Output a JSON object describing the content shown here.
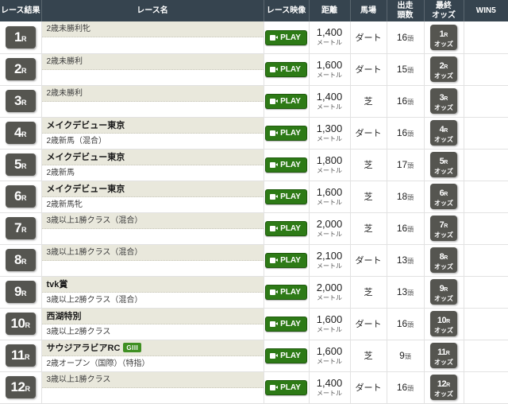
{
  "table": {
    "headers": {
      "result": "レース結果",
      "race_name": "レース名",
      "video": "レース映像",
      "distance": "距離",
      "surface": "馬場",
      "heads_line1": "出走",
      "heads_line2": "頭数",
      "odds_line1": "最終",
      "odds_line2": "オッズ",
      "win5": "WIN5"
    },
    "labels": {
      "r_suffix": "R",
      "play": "PLAY",
      "distance_unit": "メートル",
      "heads_unit": "頭",
      "odds_label": "オッズ"
    },
    "colors": {
      "header_bg": "#36444f",
      "r_button_bg": "#555550",
      "play_button_bg": "#2d7a16",
      "grade_badge_bg": "#3f8f22",
      "name_top_bg": "#e9e8dc"
    },
    "rows": [
      {
        "race_no": "1",
        "name": "2歳未勝利牝",
        "name_is_title": false,
        "condition": "",
        "grade": "",
        "video": "PLAY",
        "distance": "1,400",
        "surface": "ダート",
        "heads": "16",
        "odds_no": "1",
        "win5": ""
      },
      {
        "race_no": "2",
        "name": "2歳未勝利",
        "name_is_title": false,
        "condition": "",
        "grade": "",
        "video": "PLAY",
        "distance": "1,600",
        "surface": "ダート",
        "heads": "15",
        "odds_no": "2",
        "win5": ""
      },
      {
        "race_no": "3",
        "name": "2歳未勝利",
        "name_is_title": false,
        "condition": "",
        "grade": "",
        "video": "PLAY",
        "distance": "1,400",
        "surface": "芝",
        "heads": "16",
        "odds_no": "3",
        "win5": ""
      },
      {
        "race_no": "4",
        "name": "メイクデビュー東京",
        "name_is_title": true,
        "condition": "2歳新馬（混合）",
        "grade": "",
        "video": "PLAY",
        "distance": "1,300",
        "surface": "ダート",
        "heads": "16",
        "odds_no": "4",
        "win5": ""
      },
      {
        "race_no": "5",
        "name": "メイクデビュー東京",
        "name_is_title": true,
        "condition": "2歳新馬",
        "grade": "",
        "video": "PLAY",
        "distance": "1,800",
        "surface": "芝",
        "heads": "17",
        "odds_no": "5",
        "win5": ""
      },
      {
        "race_no": "6",
        "name": "メイクデビュー東京",
        "name_is_title": true,
        "condition": "2歳新馬牝",
        "grade": "",
        "video": "PLAY",
        "distance": "1,600",
        "surface": "芝",
        "heads": "18",
        "odds_no": "6",
        "win5": ""
      },
      {
        "race_no": "7",
        "name": "3歳以上1勝クラス（混合）",
        "name_is_title": false,
        "condition": "",
        "grade": "",
        "video": "PLAY",
        "distance": "2,000",
        "surface": "芝",
        "heads": "16",
        "odds_no": "7",
        "win5": ""
      },
      {
        "race_no": "8",
        "name": "3歳以上1勝クラス（混合）",
        "name_is_title": false,
        "condition": "",
        "grade": "",
        "video": "PLAY",
        "distance": "2,100",
        "surface": "ダート",
        "heads": "13",
        "odds_no": "8",
        "win5": ""
      },
      {
        "race_no": "9",
        "name": "tvk賞",
        "name_is_title": true,
        "condition": "3歳以上2勝クラス（混合）",
        "grade": "",
        "video": "PLAY",
        "distance": "2,000",
        "surface": "芝",
        "heads": "13",
        "odds_no": "9",
        "win5": ""
      },
      {
        "race_no": "10",
        "name": "西湖特別",
        "name_is_title": true,
        "condition": "3歳以上2勝クラス",
        "grade": "",
        "video": "PLAY",
        "distance": "1,600",
        "surface": "ダート",
        "heads": "16",
        "odds_no": "10",
        "win5": ""
      },
      {
        "race_no": "11",
        "name": "サウジアラビアRC",
        "name_is_title": true,
        "condition": "2歳オープン（国際）（特指）",
        "grade": "GIII",
        "video": "PLAY",
        "distance": "1,600",
        "surface": "芝",
        "heads": "9",
        "odds_no": "11",
        "win5": ""
      },
      {
        "race_no": "12",
        "name": "3歳以上1勝クラス",
        "name_is_title": false,
        "condition": "",
        "grade": "",
        "video": "PLAY",
        "distance": "1,400",
        "surface": "ダート",
        "heads": "16",
        "odds_no": "12",
        "win5": ""
      }
    ]
  }
}
